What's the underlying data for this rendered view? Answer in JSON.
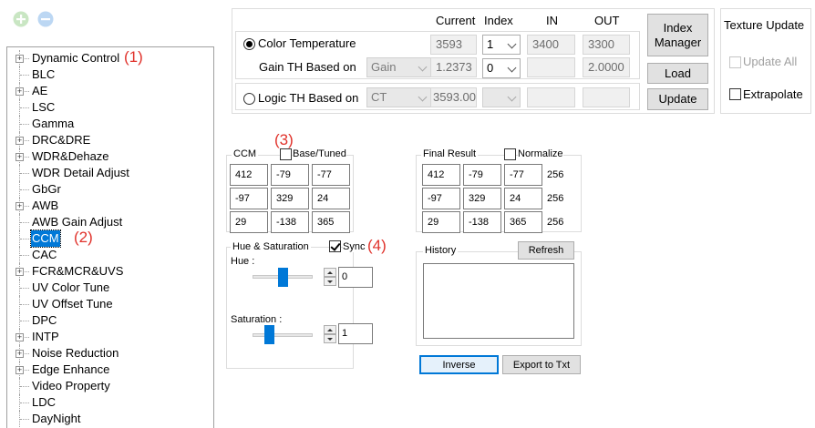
{
  "toolbar": {
    "add_icon": "plus-circle-icon",
    "remove_icon": "minus-circle-icon"
  },
  "tree": {
    "items": [
      {
        "label": "Dynamic Control",
        "expandable": true
      },
      {
        "label": "BLC",
        "expandable": false
      },
      {
        "label": "AE",
        "expandable": true
      },
      {
        "label": "LSC",
        "expandable": false
      },
      {
        "label": "Gamma",
        "expandable": false
      },
      {
        "label": "DRC&DRE",
        "expandable": true
      },
      {
        "label": "WDR&Dehaze",
        "expandable": true
      },
      {
        "label": "WDR Detail Adjust",
        "expandable": false
      },
      {
        "label": "GbGr",
        "expandable": false
      },
      {
        "label": "AWB",
        "expandable": true
      },
      {
        "label": "AWB Gain Adjust",
        "expandable": false
      },
      {
        "label": "CCM",
        "expandable": false,
        "selected": true
      },
      {
        "label": "CAC",
        "expandable": false
      },
      {
        "label": "FCR&MCR&UVS",
        "expandable": true
      },
      {
        "label": "UV Color Tune",
        "expandable": false
      },
      {
        "label": "UV Offset Tune",
        "expandable": false
      },
      {
        "label": "DPC",
        "expandable": false
      },
      {
        "label": "INTP",
        "expandable": true
      },
      {
        "label": "Noise Reduction",
        "expandable": true
      },
      {
        "label": "Edge Enhance",
        "expandable": true
      },
      {
        "label": "Video Property",
        "expandable": false
      },
      {
        "label": "LDC",
        "expandable": false
      },
      {
        "label": "DayNight",
        "expandable": false
      }
    ]
  },
  "annotations": {
    "a1": "(1)",
    "a2": "(2)",
    "a3": "(3)",
    "a4": "(4)"
  },
  "param": {
    "col_current": "Current",
    "col_index": "Index",
    "col_in": "IN",
    "col_out": "OUT",
    "color_temp_label": "Color Temperature",
    "color_temp_current": "3593",
    "color_temp_index": "1",
    "color_temp_in": "3400",
    "color_temp_out": "3300",
    "gain_th_label": "Gain TH Based on",
    "gain_th_combo": "Gain",
    "gain_th_current": "1.2373",
    "gain_th_index": "0",
    "gain_th_in": "",
    "gain_th_out": "2.0000",
    "logic_th_label": "Logic TH Based on",
    "logic_th_combo": "CT",
    "logic_th_current": "3593.00",
    "logic_th_index": "",
    "logic_th_in": "",
    "logic_th_out": ""
  },
  "buttons": {
    "index_manager_line1": "Index",
    "index_manager_line2": "Manager",
    "load": "Load",
    "update": "Update",
    "refresh": "Refresh",
    "inverse": "Inverse",
    "export": "Export to Txt"
  },
  "texture": {
    "title": "Texture Update",
    "update_all": "Update All",
    "extrapolate": "Extrapolate"
  },
  "ccm": {
    "title": "CCM",
    "base_tuned": "Base/Tuned",
    "matrix": [
      [
        "412",
        "-79",
        "-77"
      ],
      [
        "-97",
        "329",
        "24"
      ],
      [
        "29",
        "-138",
        "365"
      ]
    ]
  },
  "final": {
    "title": "Final Result",
    "normalize": "Normalize",
    "matrix": [
      [
        "412",
        "-79",
        "-77"
      ],
      [
        "-97",
        "329",
        "24"
      ],
      [
        "29",
        "-138",
        "365"
      ]
    ],
    "row_sums": [
      "256",
      "256",
      "256"
    ]
  },
  "hue_sat": {
    "title": "Hue & Saturation",
    "sync": "Sync",
    "hue_label": "Hue :",
    "hue_value": "0",
    "sat_label": "Saturation :",
    "sat_value": "1"
  },
  "history": {
    "title": "History"
  }
}
